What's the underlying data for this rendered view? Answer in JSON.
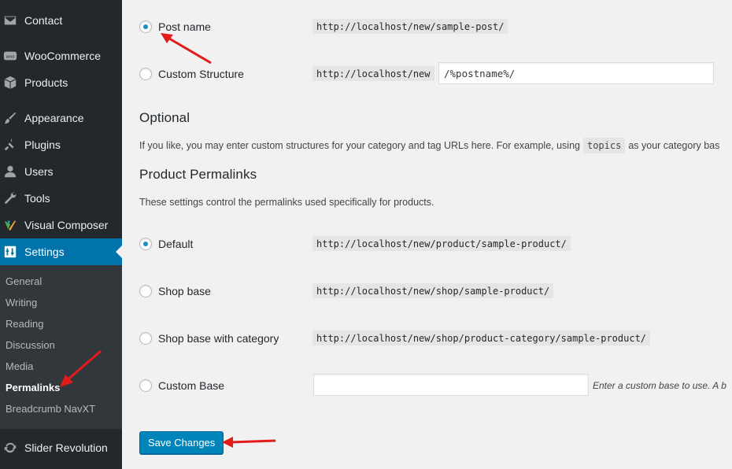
{
  "sidebar": {
    "items": [
      {
        "label": "Contact",
        "icon": "envelope-icon",
        "active": false
      },
      {
        "label": "WooCommerce",
        "icon": "woocommerce-icon",
        "active": false
      },
      {
        "label": "Products",
        "icon": "cube-icon",
        "active": false
      },
      {
        "label": "Appearance",
        "icon": "paintbrush-icon",
        "active": false
      },
      {
        "label": "Plugins",
        "icon": "plug-icon",
        "active": false
      },
      {
        "label": "Users",
        "icon": "user-icon",
        "active": false
      },
      {
        "label": "Tools",
        "icon": "wrench-icon",
        "active": false
      },
      {
        "label": "Visual Composer",
        "icon": "visual-composer-icon",
        "active": false
      },
      {
        "label": "Settings",
        "icon": "settings-icon",
        "active": true
      },
      {
        "label": "Slider Revolution",
        "icon": "refresh-icon",
        "active": false
      }
    ],
    "submenu": [
      "General",
      "Writing",
      "Reading",
      "Discussion",
      "Media",
      "Permalinks",
      "Breadcrumb NavXT"
    ],
    "current_submenu": "Permalinks"
  },
  "common": {
    "post_name": {
      "label": "Post name",
      "example": "http://localhost/new/sample-post/",
      "checked": true
    },
    "custom_structure": {
      "label": "Custom Structure",
      "prefix": "http://localhost/new",
      "value": "/%postname%/",
      "checked": false
    }
  },
  "optional": {
    "heading": "Optional",
    "description_before": "If you like, you may enter custom structures for your category and tag URLs here. For example, using",
    "description_code": "topics",
    "description_after": "as your category bas"
  },
  "product_permalinks": {
    "heading": "Product Permalinks",
    "description": "These settings control the permalinks used specifically for products.",
    "options": [
      {
        "label": "Default",
        "example": "http://localhost/new/product/sample-product/",
        "checked": true
      },
      {
        "label": "Shop base",
        "example": "http://localhost/new/shop/sample-product/",
        "checked": false
      },
      {
        "label": "Shop base with category",
        "example": "http://localhost/new/shop/product-category/sample-product/",
        "checked": false
      },
      {
        "label": "Custom Base",
        "example": "",
        "checked": false
      }
    ],
    "custom_base_hint": "Enter a custom base to use. A b"
  },
  "save_button": "Save Changes",
  "colors": {
    "sidebar_bg": "#23282d",
    "active": "#0073aa",
    "button": "#0085ba",
    "annotation_arrow": "#e21b1b"
  }
}
